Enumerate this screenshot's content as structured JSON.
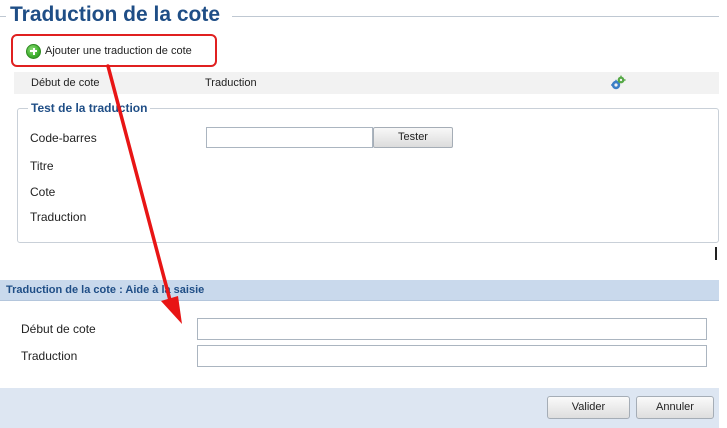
{
  "section": {
    "title": "Traduction de la cote"
  },
  "add_button": {
    "label": "Ajouter une traduction de cote"
  },
  "columns": {
    "debut": "Début de cote",
    "traduction": "Traduction"
  },
  "test_fieldset": {
    "legend": "Test de la traduction",
    "labels": {
      "code": "Code-barres",
      "titre": "Titre",
      "cote": "Cote",
      "traduction": "Traduction"
    },
    "code_value": "",
    "tester_label": "Tester"
  },
  "helper": {
    "header": "Traduction de la cote : Aide à la saisie",
    "debut_label": "Début de cote",
    "traduction_label": "Traduction",
    "debut_value": "",
    "traduction_value": ""
  },
  "footer": {
    "validate_label": "Valider",
    "cancel_label": "Annuler"
  },
  "colors": {
    "title": "#1f4e86",
    "highlight": "#e02020",
    "panel": "#c9d9ec",
    "footer": "#dde6f2"
  },
  "icons": {
    "add": "add-circle-icon",
    "config": "gears-icon"
  }
}
